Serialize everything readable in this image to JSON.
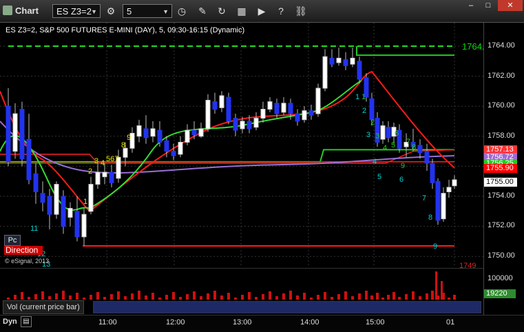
{
  "window": {
    "title": "Chart"
  },
  "toolbar": {
    "symbol_value": "ES Z3=2",
    "interval_value": "5",
    "icons": [
      "settings-icon",
      "clock-icon",
      "pencil-icon",
      "refresh-icon",
      "settings-icon",
      "play-icon",
      "help-icon",
      "link-icon"
    ]
  },
  "chart": {
    "header": "ES Z3=2, S&P 500 FUTURES E-MINI (DAY), 5, 09:30-16:15 (Dynamic)",
    "y_ticks": [
      "1764.00",
      "1762.00",
      "1760.00",
      "1758.00",
      "1756.00",
      "1754.00",
      "1752.00",
      "1750.00"
    ],
    "price_tags": [
      {
        "text": "1764.",
        "color": "#00dd00"
      },
      {
        "text": "1757.13",
        "color": "#ff3333"
      },
      {
        "text": "1756.72",
        "color": "#a06ad6"
      },
      {
        "text": "1756.25",
        "color": "#22cc22"
      },
      {
        "text": "1755.90",
        "color": "#ff0000"
      },
      {
        "text": "1755.00",
        "color": "#ffffff"
      },
      {
        "text": "1749",
        "color": "#dd2222"
      }
    ],
    "count_labels": [
      {
        "text": "11",
        "color": "#00d0d0"
      },
      {
        "text": "12",
        "color": "#00d0d0"
      },
      {
        "text": "13",
        "color": "#00d0d0"
      },
      {
        "text": "1",
        "color": "#e6e600"
      },
      {
        "text": "2",
        "color": "#e6e600"
      },
      {
        "text": "3",
        "color": "#e6e600"
      },
      {
        "text": "4",
        "color": "#e6e600"
      },
      {
        "text": "567",
        "color": "#e6e600"
      },
      {
        "text": "8",
        "color": "#e6e600"
      },
      {
        "text": "9",
        "color": "#e6e600"
      },
      {
        "text": "1",
        "color": "#00d0d0"
      },
      {
        "text": "2",
        "color": "#00d0d0"
      },
      {
        "text": "3",
        "color": "#00d0d0"
      },
      {
        "text": "4",
        "color": "#00d0d0"
      },
      {
        "text": "5",
        "color": "#00d0d0"
      },
      {
        "text": "6",
        "color": "#00d0d0"
      },
      {
        "text": "7",
        "color": "#00d0d0"
      },
      {
        "text": "8",
        "color": "#00d0d0"
      },
      {
        "text": "9",
        "color": "#00d0d0"
      },
      {
        "text": "1",
        "color": "#22cc22"
      },
      {
        "text": "2",
        "color": "#22cc22"
      },
      {
        "text": "3",
        "color": "#22cc22"
      },
      {
        "text": "4",
        "color": "#22cc22"
      },
      {
        "text": "5",
        "color": "#22cc22"
      },
      {
        "text": "6",
        "color": "#22cc22"
      },
      {
        "text": "7",
        "color": "#22cc22"
      },
      {
        "text": "8",
        "color": "#22cc22"
      },
      {
        "text": "9",
        "color": "#22cc22"
      }
    ],
    "pc_label": "Pc",
    "direction_label": "Direction",
    "watermark": "© eSignal, 2013"
  },
  "volume": {
    "label": "Vol (current price bar)",
    "y_tick": "100000",
    "current": "19220"
  },
  "time_axis": {
    "labels": [
      "11:00",
      "12:00",
      "13:00",
      "14:00",
      "15:00",
      "01"
    ]
  },
  "footer": {
    "dyn": "Dyn"
  }
}
